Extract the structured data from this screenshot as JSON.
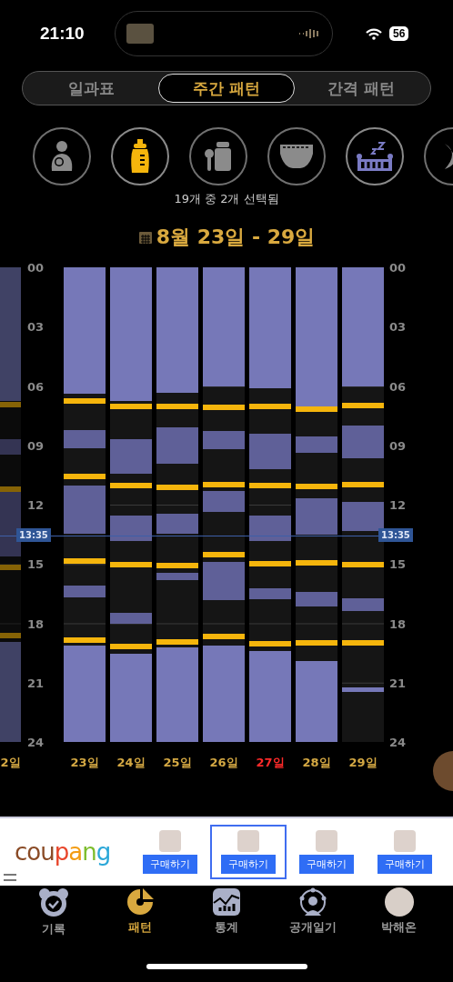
{
  "status_bar": {
    "time": "21:10",
    "battery": "56"
  },
  "tabs": [
    {
      "label": "일과표",
      "selected": false
    },
    {
      "label": "주간 패턴",
      "selected": true
    },
    {
      "label": "간격 패턴",
      "selected": false
    }
  ],
  "categories": [
    {
      "kind": "nursing",
      "selected": false
    },
    {
      "kind": "bottle",
      "selected": true,
      "color": "#f5b50c"
    },
    {
      "kind": "baby_food",
      "selected": false
    },
    {
      "kind": "diaper",
      "selected": false
    },
    {
      "kind": "sleep",
      "selected": true,
      "color": "#7a7bc4"
    },
    {
      "kind": "moon",
      "selected": false
    }
  ],
  "selection_caption": "19개 중 2개 선택됨",
  "date_range": "8월 23일 - 29일",
  "chart": {
    "now_label_left": "13:35",
    "now_label_right": "13:35",
    "left_axis_labels": [
      "00",
      "03",
      "06",
      "09",
      "12",
      "15",
      "18",
      "21",
      "24"
    ],
    "right_axis_labels": [
      "00",
      "03",
      "06",
      "09",
      "12",
      "15",
      "18",
      "21",
      "24"
    ],
    "days": [
      {
        "label": "2일",
        "faded": true,
        "color": "#d4a843"
      },
      {
        "label": "23일",
        "faded": false,
        "color": "#d4a843"
      },
      {
        "label": "24일",
        "faded": false,
        "color": "#d4a843"
      },
      {
        "label": "25일",
        "faded": false,
        "color": "#d4a843"
      },
      {
        "label": "26일",
        "faded": false,
        "color": "#d4a843"
      },
      {
        "label": "27일",
        "faded": false,
        "color": "#ff2a2a"
      },
      {
        "label": "28일",
        "faded": false,
        "color": "#d4a843"
      },
      {
        "label": "29일",
        "faded": false,
        "color": "#d4a843"
      }
    ]
  },
  "ad": {
    "brand": "coupang",
    "products": [
      {
        "button": "구매하기",
        "selected": false
      },
      {
        "button": "구매하기",
        "selected": true
      },
      {
        "button": "구매하기",
        "selected": false
      },
      {
        "button": "구매하기",
        "selected": false
      }
    ]
  },
  "nav": [
    {
      "kind": "record",
      "label": "기록",
      "selected": false
    },
    {
      "kind": "pattern",
      "label": "패턴",
      "selected": true
    },
    {
      "kind": "stats",
      "label": "통계",
      "selected": false
    },
    {
      "kind": "diary",
      "label": "공개일기",
      "selected": false
    },
    {
      "kind": "profile",
      "label": "박해온",
      "selected": false
    }
  ]
}
